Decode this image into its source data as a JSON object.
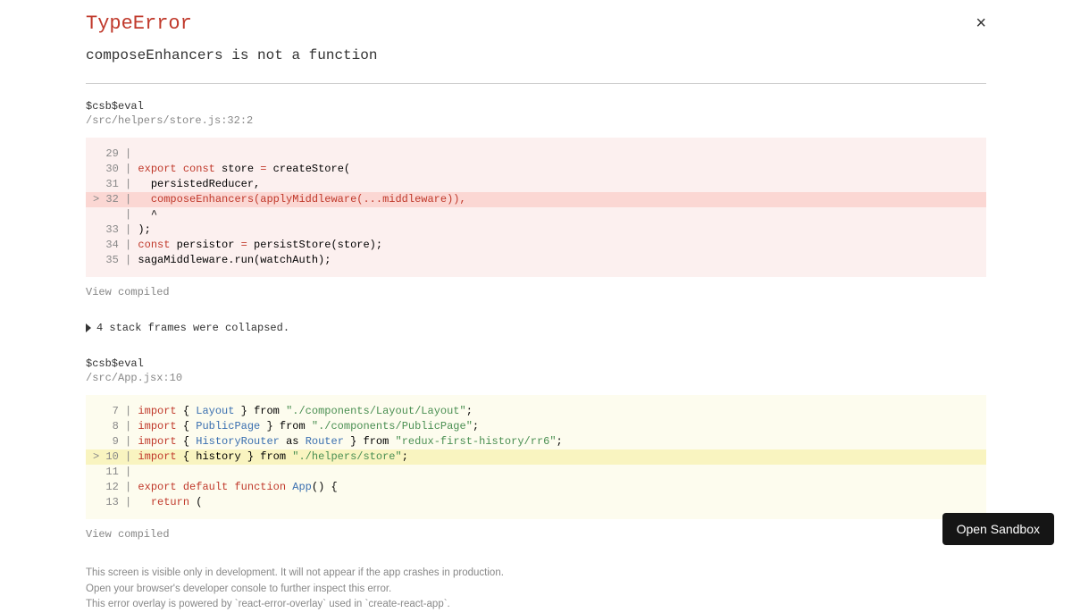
{
  "header": {
    "error_type": "TypeError",
    "close_glyph": "×",
    "message": "composeEnhancers is not a function"
  },
  "frames": [
    {
      "fn": "$csb$eval",
      "loc": "/src/helpers/store.js:32:2",
      "theme": "red",
      "view_compiled": "View compiled",
      "lines": [
        {
          "pfx": "  ",
          "n": "29",
          "html": ""
        },
        {
          "pfx": "  ",
          "n": "30",
          "html": "<span class=\"k-red\">export</span> <span class=\"k-red\">const</span> store <span class=\"k-red\">=</span> createStore("
        },
        {
          "pfx": "  ",
          "n": "31",
          "html": "  persistedReducer,"
        },
        {
          "pfx": "> ",
          "n": "32",
          "hl": true,
          "html": "  <span class=\"k-red\">composeEnhancers(applyMiddleware(...middleware)),</span>"
        },
        {
          "pfx": "  ",
          "n": "  ",
          "hl": false,
          "caret": true,
          "html": "  ^"
        },
        {
          "pfx": "  ",
          "n": "33",
          "html": ");"
        },
        {
          "pfx": "  ",
          "n": "34",
          "html": "<span class=\"k-red\">const</span> persistor <span class=\"k-red\">=</span> persistStore(store);"
        },
        {
          "pfx": "  ",
          "n": "35",
          "html": "sagaMiddleware.run(watchAuth);"
        }
      ]
    },
    {
      "fn": "$csb$eval",
      "loc": "/src/App.jsx:10",
      "theme": "yellow",
      "view_compiled": "View compiled",
      "lines": [
        {
          "pfx": "  ",
          "n": " 7",
          "html": "<span class=\"k-red\">import</span> { <span class=\"k-blue\">Layout</span> } from <span class=\"k-green\">&quot;./components/Layout/Layout&quot;</span>;"
        },
        {
          "pfx": "  ",
          "n": " 8",
          "html": "<span class=\"k-red\">import</span> { <span class=\"k-blue\">PublicPage</span> } from <span class=\"k-green\">&quot;./components/PublicPage&quot;</span>;"
        },
        {
          "pfx": "  ",
          "n": " 9",
          "html": "<span class=\"k-red\">import</span> { <span class=\"k-blue\">HistoryRouter</span> as <span class=\"k-blue\">Router</span> } from <span class=\"k-green\">&quot;redux-first-history/rr6&quot;</span>;"
        },
        {
          "pfx": "> ",
          "n": "10",
          "hl": true,
          "html": "<span class=\"k-red\">import</span> { history } from <span class=\"k-green\">&quot;./helpers/store&quot;</span>;"
        },
        {
          "pfx": "  ",
          "n": "11",
          "html": ""
        },
        {
          "pfx": "  ",
          "n": "12",
          "html": "<span class=\"k-red\">export</span> <span class=\"k-red\">default</span> <span class=\"k-red\">function</span> <span class=\"k-blue\">App</span>() {"
        },
        {
          "pfx": "  ",
          "n": "13",
          "html": "  <span class=\"k-red\">return</span> ("
        }
      ]
    }
  ],
  "collapsed": "4 stack frames were collapsed.",
  "footer": {
    "line1": "This screen is visible only in development. It will not appear if the app crashes in production.",
    "line2": "Open your browser's developer console to further inspect this error.",
    "line3": "This error overlay is powered by `react-error-overlay` used in `create-react-app`."
  },
  "sandbox_button": "Open Sandbox"
}
